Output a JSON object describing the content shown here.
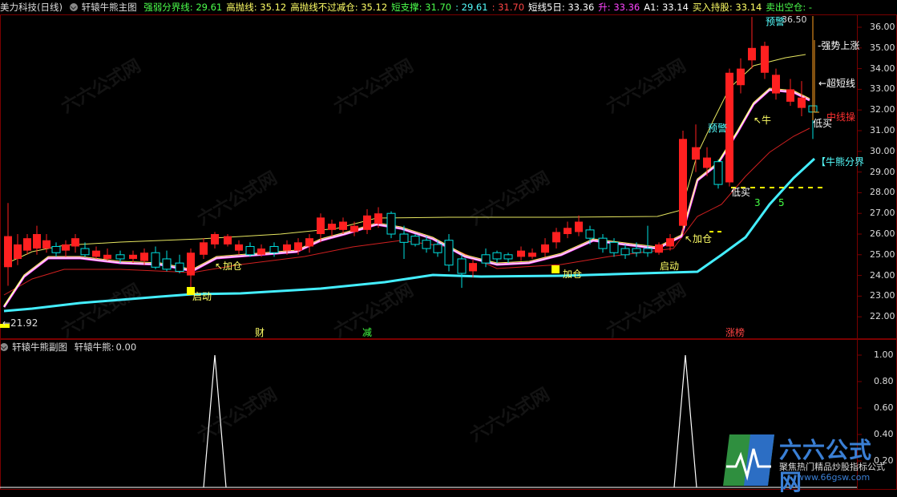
{
  "main_header": {
    "stock": "美力科技(日线)",
    "indicator": "轩辕牛熊主图",
    "items": [
      {
        "label": "强弱分界线:",
        "value": "29.61",
        "color": "#4cff4c"
      },
      {
        "label": "高抛线:",
        "value": "35.12",
        "color": "#ffff66"
      },
      {
        "label": "高抛线不过减仓:",
        "value": "35.12",
        "color": "#ffff66"
      },
      {
        "label": "短支撑:",
        "value": "31.70",
        "color": "#4cff4c"
      },
      {
        "label": ":",
        "value": "29.61",
        "color": "#55ffff"
      },
      {
        "label": ":",
        "value": "31.70",
        "color": "#ff4444"
      },
      {
        "label": "短线5日:",
        "value": "33.36",
        "color": "#ffffff"
      },
      {
        "label": "升:",
        "value": "33.36",
        "color": "#ff44ff"
      },
      {
        "label": "A1:",
        "value": "33.14",
        "color": "#ffffff"
      },
      {
        "label": "买入持股:",
        "value": "33.14",
        "color": "#ffff66"
      },
      {
        "label": "卖出空仓:",
        "value": "-",
        "color": "#4cff4c"
      }
    ]
  },
  "sub_header": {
    "indicator": "轩辕牛熊副图",
    "label": "轩辕牛熊:",
    "value": "0.00"
  },
  "price_axis": [
    "36.00",
    "35.00",
    "34.00",
    "33.00",
    "32.00",
    "31.00",
    "30.00",
    "29.00",
    "28.00",
    "27.00",
    "26.00",
    "25.00",
    "24.00",
    "23.00",
    "22.00"
  ],
  "sub_axis": [
    "1.00",
    "0.80",
    "0.60",
    "0.40",
    "0.20"
  ],
  "annotations": {
    "low_price": "←21.92",
    "high_price": "36.50",
    "warn_top": "预警",
    "warn_mid": "预警",
    "qiangshi": "-强势上涨",
    "chaoduan": "←超短线",
    "zhongxian": "中线操",
    "dimai1": "低买",
    "dimai2": "低买",
    "niuxiong": "【牛熊分界",
    "niu": "↖牛",
    "jiacang1": "↖加仓",
    "jiacang2": "↖加仓",
    "jiacang3": "加仓",
    "qidong1": "启动",
    "qidong2": "启动",
    "num3": "3",
    "num5": "5",
    "event_cai": "财",
    "event_jian": "减",
    "event_zhangbang": "涨榜"
  },
  "logo": {
    "title": "六六公式网",
    "subtitle": "聚焦热门精品炒股指标公式",
    "url": "www.66gsw.com"
  },
  "watermark_text": "六六公式网",
  "colors": {
    "bg": "#000000",
    "border": "#7a0000",
    "up": "#ff2020",
    "down": "#00e0e0",
    "support": "#44eeff"
  }
}
